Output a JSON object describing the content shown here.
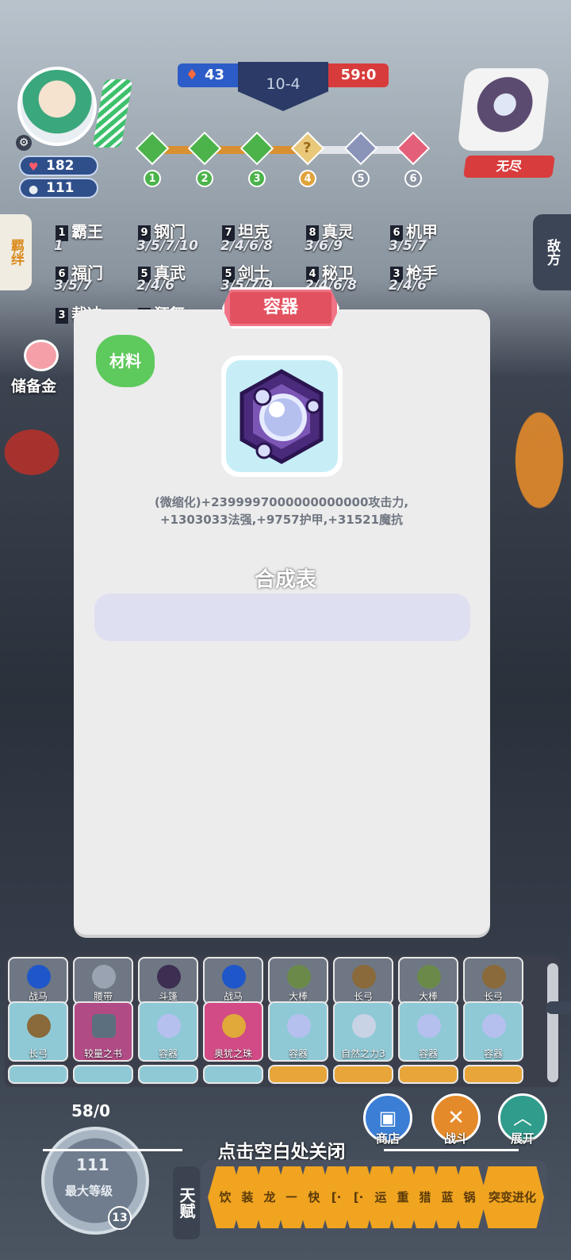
{
  "hud": {
    "player_health": "182",
    "player_gold": "111",
    "score_left": "43",
    "round": "10-4",
    "score_right": "59:0",
    "opponent_label": "无尽",
    "stages": [
      "1",
      "2",
      "3",
      "4",
      "5",
      "6"
    ],
    "stage4_symbol": "?",
    "progress_fraction": 0.62
  },
  "side_tabs": {
    "left": "羁绊",
    "right": "敌方"
  },
  "traits": {
    "col1": [
      {
        "num": "1",
        "name": "霸王",
        "sub": "1"
      },
      {
        "num": "6",
        "name": "福门",
        "sub": "3/5/7"
      },
      {
        "num": "3",
        "name": "裁决",
        "sub": ""
      }
    ],
    "col2": [
      {
        "num": "9",
        "name": "钢门",
        "sub": "3/5/7/10"
      },
      {
        "num": "5",
        "name": "真武",
        "sub": "2/4/6"
      },
      {
        "num": "2",
        "name": "狂舞",
        "sub": ""
      }
    ],
    "col3": [
      {
        "num": "7",
        "name": "坦克",
        "sub": "2/4/6/8"
      },
      {
        "num": "5",
        "name": "剑士",
        "sub": "3/5/7/9"
      }
    ],
    "col4": [
      {
        "num": "8",
        "name": "真灵",
        "sub": "3/6/9"
      },
      {
        "num": "4",
        "name": "秘卫",
        "sub": "2/4/6/8"
      }
    ],
    "col5": [
      {
        "num": "6",
        "name": "机甲",
        "sub": "3/5/7"
      },
      {
        "num": "3",
        "name": "枪手",
        "sub": "2/4/6"
      }
    ]
  },
  "piggy": {
    "label": "储备金"
  },
  "modal": {
    "title": "容器",
    "tag": "材料",
    "description_line1": "(微缩化)+2399997000000000000攻击力,",
    "description_line2": "+1303033法强,+9757护甲,+31521魔抗",
    "recipe_title": "合成表"
  },
  "bench": {
    "row1": [
      "战马",
      "腰带",
      "斗篷",
      "战马",
      "大棒",
      "长弓",
      "大棒",
      "长弓"
    ],
    "row2": [
      "长弓",
      "较量之书",
      "容器",
      "奥犹之珠",
      "容器",
      "自然之力3",
      "容器",
      "容器"
    ]
  },
  "level": {
    "top": "58/0",
    "value": "111",
    "label": "最大等级",
    "badge": "13"
  },
  "close_hint": "点击空白处关闭",
  "actions": {
    "shop": "商店",
    "fight": "战斗",
    "expand": "展开"
  },
  "talent": {
    "tab": "天赋",
    "items": [
      "饮",
      "装",
      "龙",
      "一",
      "快",
      "[·",
      "[·",
      "运",
      "重",
      "猎",
      "蓝",
      "锅"
    ],
    "last": "突变进化"
  },
  "colors": {
    "modal_bg": "#ececec",
    "title_red": "#e2515f",
    "material_green": "#5ec95d",
    "item_bg": "#c7eef7",
    "recipe_box": "#dfdff2"
  }
}
